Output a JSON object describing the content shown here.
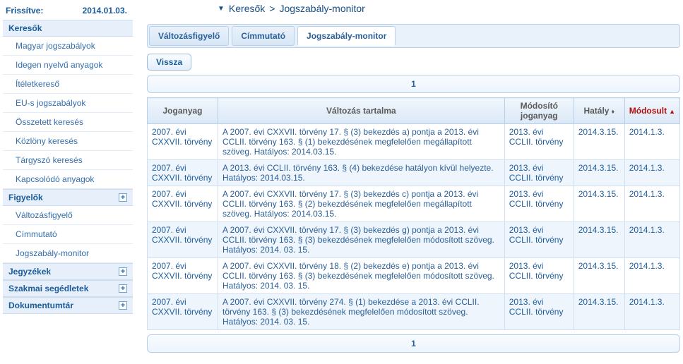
{
  "refresh": {
    "label": "Frissítve:",
    "date": "2014.01.03."
  },
  "sidebar": {
    "groups": [
      {
        "title": "Keresők",
        "expand": false,
        "items": [
          "Magyar jogszabályok",
          "Idegen nyelvű anyagok",
          "Ítéletkereső",
          "EU-s jogszabályok",
          "Összetett keresés",
          "Közlöny keresés",
          "Tárgyszó keresés",
          "Kapcsolódó anyagok"
        ]
      },
      {
        "title": "Figyelők",
        "expand": true,
        "items": [
          "Változásfigyelő",
          "Címmutató",
          "Jogszabály-monitor"
        ]
      },
      {
        "title": "Jegyzékek",
        "expand": true,
        "items": []
      },
      {
        "title": "Szakmai segédletek",
        "expand": true,
        "items": []
      },
      {
        "title": "Dokumentumtár",
        "expand": true,
        "items": []
      }
    ]
  },
  "breadcrumb": {
    "l1": "Keresők",
    "sep": ">",
    "l2": "Jogszabály-monitor"
  },
  "tabs": {
    "items": [
      "Változásfigyelő",
      "Címmutató",
      "Jogszabály-monitor"
    ],
    "active": 2
  },
  "back": {
    "label": "Vissza"
  },
  "pager": {
    "page": "1"
  },
  "table": {
    "headers": {
      "joganyag": "Joganyag",
      "valtozas": "Változás tartalma",
      "modosito": "Módosító joganyag",
      "hataly": "Hatály",
      "modosult": "Módosult"
    },
    "rows": [
      {
        "joganyag": "2007. évi CXXVII. törvény",
        "valtozas": "A 2007. évi CXXVII. törvény 17. § (3) bekezdés a) pontja a 2013. évi CCLII. törvény 163. § (1) bekezdésének megfelelően megállapított szöveg. Hatályos: 2014.03.15.",
        "modosito": "2013. évi CCLII. törvény",
        "hataly": "2014.3.15.",
        "modosult": "2014.1.3."
      },
      {
        "joganyag": "2007. évi CXXVII. törvény",
        "valtozas": "A 2013. évi CCLII. törvény 163. § (4) bekezdése hatályon kívül helyezte. Hatályos: 2014.03.15.",
        "modosito": "2013. évi CCLII. törvény",
        "hataly": "2014.3.15.",
        "modosult": "2014.1.3."
      },
      {
        "joganyag": "2007. évi CXXVII. törvény",
        "valtozas": "A 2007. évi CXXVII. törvény 17. § (3) bekezdés c) pontja a 2013. évi CCLII. törvény 163. § (2) bekezdésének megfelelően megállapított szöveg. Hatályos: 2014.03.15.",
        "modosito": "2013. évi CCLII. törvény",
        "hataly": "2014.3.15.",
        "modosult": "2014.1.3."
      },
      {
        "joganyag": "2007. évi CXXVII. törvény",
        "valtozas": "A 2007. évi CXXVII. törvény 17. § (3) bekezdés g) pontja a 2013. évi CCLII. törvény 163. § (3) bekezdésének megfelelően módosított szöveg. Hatályos: 2014. 03. 15.",
        "modosito": "2013. évi CCLII. törvény",
        "hataly": "2014.3.15.",
        "modosult": "2014.1.3."
      },
      {
        "joganyag": "2007. évi CXXVII. törvény",
        "valtozas": "A 2007. évi CXXVII. törvény 18. § (2) bekezdés e) pontja a 2013. évi CCLII. törvény 163. § (3) bekezdésének megfelelően módosított szöveg. Hatályos: 2014. 03. 15.",
        "modosito": "2013. évi CCLII. törvény",
        "hataly": "2014.3.15.",
        "modosult": "2014.1.3."
      },
      {
        "joganyag": "2007. évi CXXVII. törvény",
        "valtozas": "A 2007. évi CXXVII. törvény 274. § (1) bekezdése a 2013. évi CCLII. törvény 163. § (3) bekezdésének megfelelően módosított szöveg. Hatályos: 2014. 03. 15.",
        "modosito": "2013. évi CCLII. törvény",
        "hataly": "2014.3.15.",
        "modosult": "2014.1.3."
      }
    ]
  }
}
